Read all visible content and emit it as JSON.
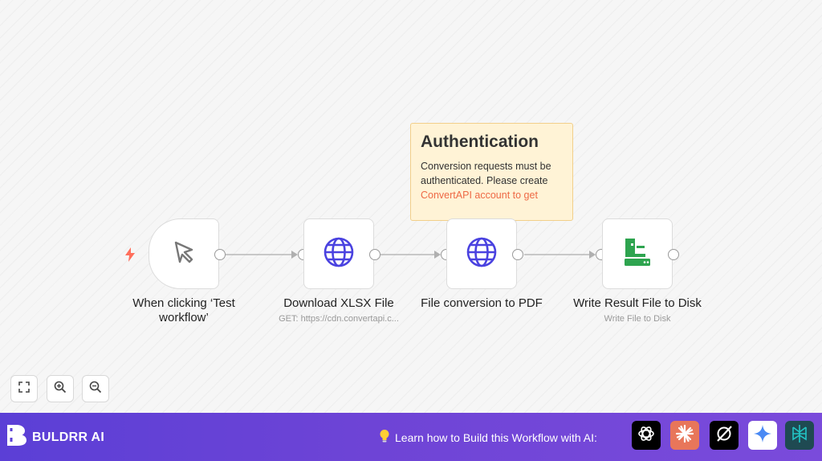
{
  "nodes": [
    {
      "label": "When clicking ‘Test workflow’",
      "icon": "cursor-icon"
    },
    {
      "label": "Download XLSX File",
      "subtitle": "GET: https://cdn.convertapi.c...",
      "icon": "globe-icon"
    },
    {
      "label": "File conversion to PDF",
      "icon": "globe-icon"
    },
    {
      "label": "Write Result File to Disk",
      "subtitle": "Write File to Disk",
      "icon": "disk-write-icon"
    }
  ],
  "sticky": {
    "title": "Authentication",
    "body": "Conversion requests must be authenticated. Please create",
    "link": "ConvertAPI account to get"
  },
  "footer": {
    "brand": "BULDRR AI",
    "learn_text": "Learn how to Build this Workflow with AI:"
  },
  "colors": {
    "accent": "#4a42e0",
    "trigger": "#ff6f5c",
    "sticky_bg": "#fff3d6",
    "footer": "#6a44d8",
    "disk_green": "#2ea44f"
  }
}
